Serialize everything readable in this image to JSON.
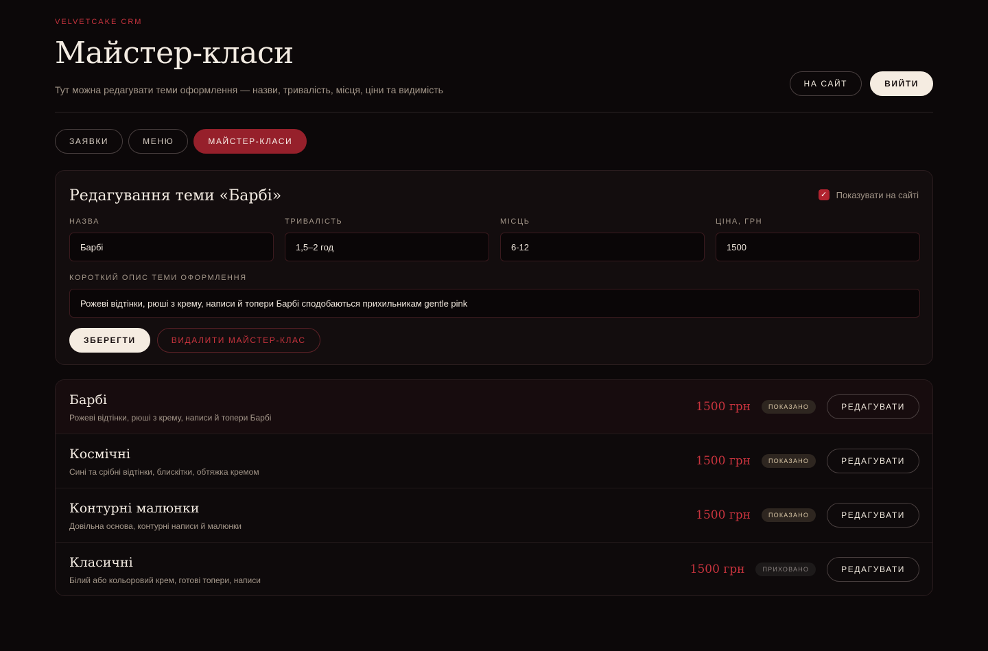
{
  "header": {
    "brand": "VELVETCAKE CRM",
    "title": "Майстер-класи",
    "subtitle": "Тут можна редагувати теми оформлення — назви, тривалість, місця, ціни та видимість",
    "to_site_label": "НА САЙТ",
    "logout_label": "ВИЙТИ"
  },
  "tabs": [
    {
      "label": "ЗАЯВКИ",
      "active": false
    },
    {
      "label": "МЕНЮ",
      "active": false
    },
    {
      "label": "МАЙСТЕР-КЛАСИ",
      "active": true
    }
  ],
  "editor": {
    "title": "Редагування теми «Барбі»",
    "visible_label": "Показувати на сайті",
    "visible_checked": true,
    "fields": {
      "name": {
        "label": "НАЗВА",
        "value": "Барбі"
      },
      "duration": {
        "label": "ТРИВАЛІСТЬ",
        "value": "1,5–2 год"
      },
      "places": {
        "label": "МІСЦЬ",
        "value": "6-12"
      },
      "price": {
        "label": "ЦІНА, ГРН",
        "value": "1500"
      }
    },
    "description": {
      "label": "КОРОТКИЙ ОПИС ТЕМИ ОФОРМЛЕННЯ",
      "value": "Рожеві відтінки, рюші з крему, написи й топери Барбі сподобаються прихильникам gentle pink"
    },
    "save_label": "ЗБЕРЕГТИ",
    "delete_label": "ВИДАЛИТИ МАЙСТЕР-КЛАС"
  },
  "classes": [
    {
      "name": "Барбі",
      "desc": "Рожеві відтінки, рюші з крему, написи й топери Барбі",
      "price": "1500 грн",
      "status": "ПОКАЗАНО",
      "visible": true,
      "active": true,
      "edit_label": "РЕДАГУВАТИ"
    },
    {
      "name": "Космічні",
      "desc": "Сині та срібні відтінки, блискітки, обтяжка кремом",
      "price": "1500 грн",
      "status": "ПОКАЗАНО",
      "visible": true,
      "active": false,
      "edit_label": "РЕДАГУВАТИ"
    },
    {
      "name": "Контурні малюнки",
      "desc": "Довільна основа, контурні написи й малюнки",
      "price": "1500 грн",
      "status": "ПОКАЗАНО",
      "visible": true,
      "active": false,
      "edit_label": "РЕДАГУВАТИ"
    },
    {
      "name": "Класичні",
      "desc": "Білий або кольоровий крем, готові топери, написи",
      "price": "1500 грн",
      "status": "ПРИХОВАНО",
      "visible": false,
      "active": false,
      "edit_label": "РЕДАГУВАТИ"
    }
  ],
  "colors": {
    "accent": "#96202b",
    "accent_text": "#c9343e",
    "background": "#0c0809",
    "cream": "#f5ece1"
  }
}
